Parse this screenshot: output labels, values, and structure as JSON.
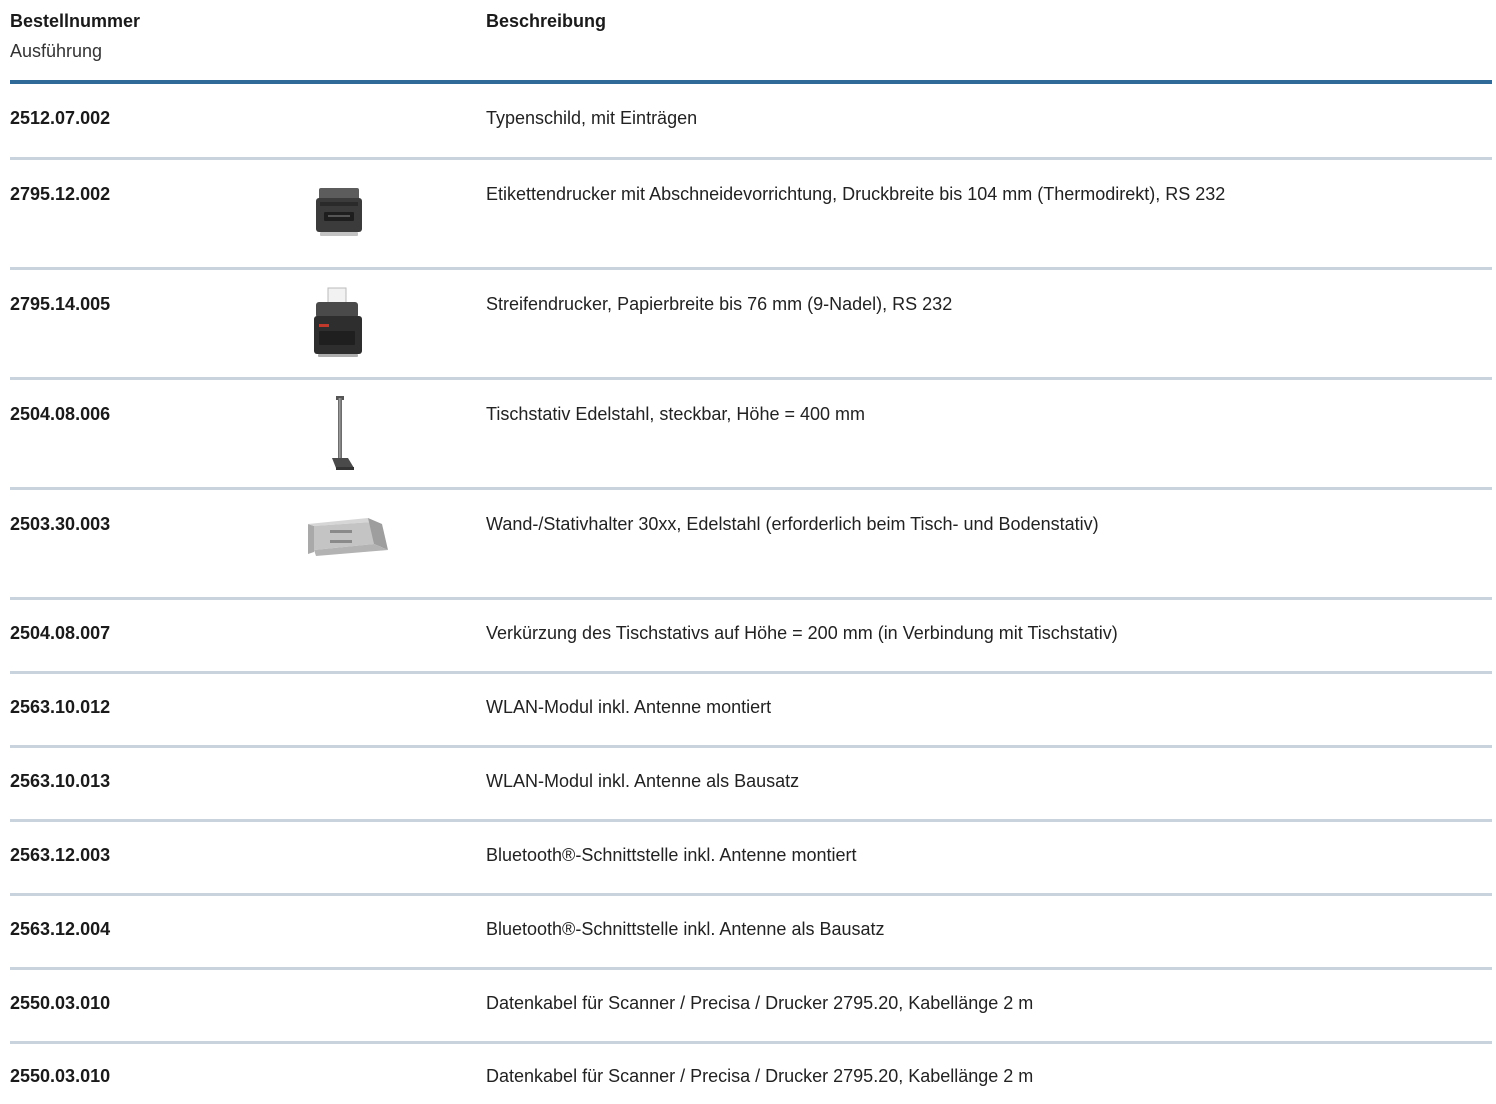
{
  "header": {
    "col1_title": "Bestellnummer",
    "col1_subtitle": "Ausführung",
    "col2_title": "Beschreibung"
  },
  "rows": [
    {
      "number": "2512.07.002",
      "description": "Typenschild, mit Einträgen",
      "image": ""
    },
    {
      "number": "2795.12.002",
      "description": "Etikettendrucker mit Abschneidevorrichtung, Druckbreite bis 104 mm (Thermodirekt), RS 232",
      "image": "label-printer-icon"
    },
    {
      "number": "2795.14.005",
      "description": "Streifendrucker, Papierbreite bis 76 mm (9-Nadel), RS 232",
      "image": "strip-printer-icon"
    },
    {
      "number": "2504.08.006",
      "description": "Tischstativ Edelstahl, steckbar, Höhe = 400 mm",
      "image": "table-stand-icon"
    },
    {
      "number": "2503.30.003",
      "description": "Wand-/Stativhalter 30xx, Edelstahl (erforderlich beim Tisch- und Bodenstativ)",
      "image": "wall-bracket-icon"
    },
    {
      "number": "2504.08.007",
      "description": "Verkürzung des Tischstativs auf Höhe = 200 mm (in Verbindung mit Tischstativ)",
      "image": ""
    },
    {
      "number": "2563.10.012",
      "description": "WLAN-Modul inkl. Antenne montiert",
      "image": ""
    },
    {
      "number": "2563.10.013",
      "description": "WLAN-Modul inkl. Antenne als Bausatz",
      "image": ""
    },
    {
      "number": "2563.12.003",
      "description": "Bluetooth®-Schnittstelle inkl. Antenne montiert",
      "image": ""
    },
    {
      "number": "2563.12.004",
      "description": "Bluetooth®-Schnittstelle inkl. Antenne als Bausatz",
      "image": ""
    },
    {
      "number": "2550.03.010",
      "description": "Datenkabel für Scanner / Precisa / Drucker 2795.20, Kabellänge 2 m",
      "image": ""
    },
    {
      "number": "2550.03.010",
      "description": "Datenkabel für Scanner / Precisa / Drucker 2795.20, Kabellänge 2 m",
      "image": ""
    }
  ]
}
